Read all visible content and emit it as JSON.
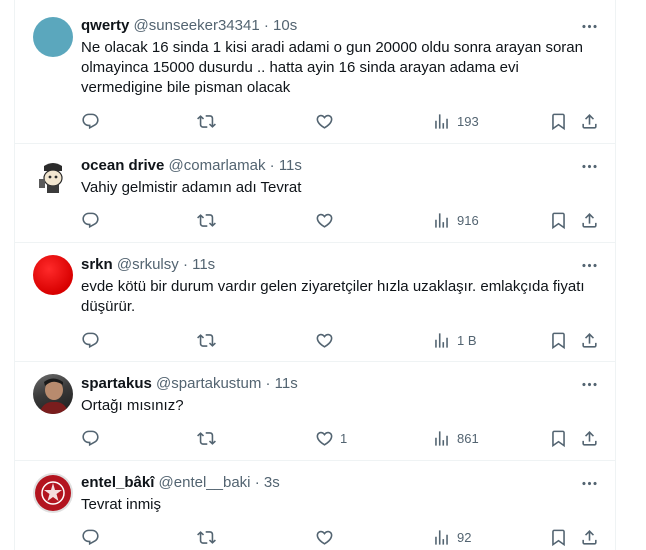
{
  "tweets": [
    {
      "name": "qwerty",
      "handle": "@sunseeker34341",
      "sep": "·",
      "time": "10s",
      "text": "Ne olacak 16 sinda 1 kisi aradi adami o gun 20000 oldu sonra arayan soran olmayinca 15000 dusurdu .. hatta ayin 16 sinda arayan adama evi vermedigine bile pisman olacak",
      "likes": "",
      "views": "193",
      "avatar": "teal-circle"
    },
    {
      "name": "ocean drive",
      "handle": "@comarlamak",
      "sep": "·",
      "time": "11s",
      "text": "Vahiy gelmistir adamın adı Tevrat",
      "likes": "",
      "views": "916",
      "avatar": "cartoon-character"
    },
    {
      "name": "srkn",
      "handle": "@srkulsy",
      "sep": "·",
      "time": "11s",
      "text": "evde kötü bir durum vardır gelen ziyaretçiler hızla uzaklaşır. emlakçıda fiyatı düşürür.",
      "likes": "",
      "views": "1 B",
      "avatar": "red-circle"
    },
    {
      "name": "spartakus",
      "handle": "@spartakustum",
      "sep": "·",
      "time": "11s",
      "text": "Ortağı mısınız?",
      "likes": "1",
      "views": "861",
      "avatar": "photo-person"
    },
    {
      "name": "entel_bâkî",
      "handle": "@entel__baki",
      "sep": "·",
      "time": "3s",
      "text": "Tevrat inmiş",
      "likes": "",
      "views": "92",
      "avatar": "red-emblem"
    }
  ],
  "colors": {
    "text": "#0f1419",
    "secondary": "#536471",
    "border": "#eff3f4"
  },
  "icons": [
    "more-icon",
    "reply-icon",
    "retweet-icon",
    "like-icon",
    "views-icon",
    "bookmark-icon",
    "share-icon"
  ]
}
